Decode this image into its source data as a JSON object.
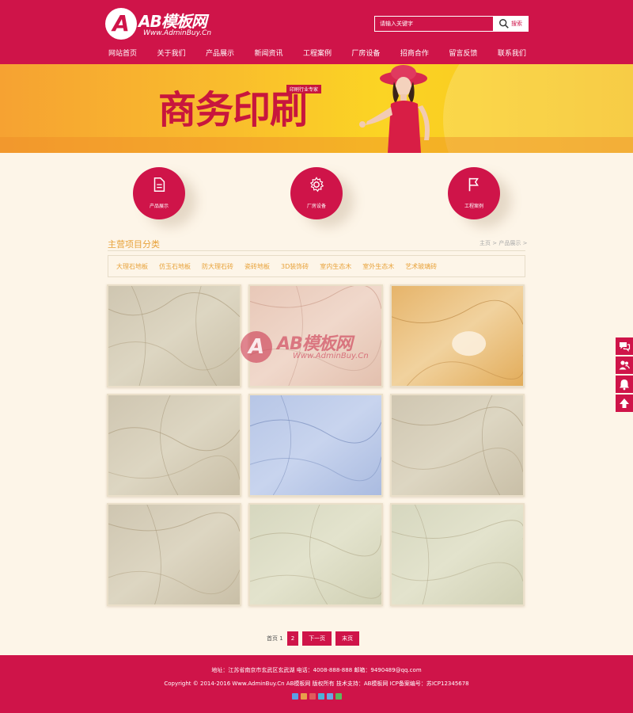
{
  "logo": {
    "mark": "A",
    "title": "AB模板网",
    "subtitle": "Www.AdminBuy.Cn"
  },
  "search": {
    "placeholder": "请输入关键字",
    "button_label": "搜索"
  },
  "nav": [
    {
      "label": "网站首页"
    },
    {
      "label": "关于我们"
    },
    {
      "label": "产品展示"
    },
    {
      "label": "新闻资讯"
    },
    {
      "label": "工程案例"
    },
    {
      "label": "厂房设备"
    },
    {
      "label": "招商合作"
    },
    {
      "label": "留言反馈"
    },
    {
      "label": "联系我们"
    }
  ],
  "banner": {
    "title": "商务印刷",
    "tag": "印刷行业专家"
  },
  "features": [
    {
      "label": "产品展示",
      "icon": "document-icon"
    },
    {
      "label": "厂房设备",
      "icon": "gear-icon"
    },
    {
      "label": "工程案例",
      "icon": "flag-icon"
    }
  ],
  "section": {
    "title": "主营项目分类"
  },
  "breadcrumb": {
    "home": "主页",
    "current": "产品展示"
  },
  "categories": [
    {
      "label": "大理石地板"
    },
    {
      "label": "仿玉石地板"
    },
    {
      "label": "防大理石砖"
    },
    {
      "label": "瓷砖地板"
    },
    {
      "label": "3D装饰砖"
    },
    {
      "label": "室内生态木"
    },
    {
      "label": "室外生态木"
    },
    {
      "label": "艺术玻璃砖"
    }
  ],
  "products": [
    {
      "texture": "beige-grey-marble"
    },
    {
      "texture": "pink-marble"
    },
    {
      "texture": "golden-marble"
    },
    {
      "texture": "beige-grey-marble"
    },
    {
      "texture": "blue-marble"
    },
    {
      "texture": "beige-grey-marble"
    },
    {
      "texture": "beige-grey-marble"
    },
    {
      "texture": "pale-green-marble"
    },
    {
      "texture": "pale-green-marble"
    }
  ],
  "watermark": {
    "mark": "A",
    "title": "AB模板网",
    "subtitle": "Www.AdminBuy.Cn"
  },
  "pagination": {
    "info": "首页 1",
    "page2": "2",
    "next": "下一页",
    "last": "末页"
  },
  "side_buttons": [
    {
      "icon": "chat-icon"
    },
    {
      "icon": "users-icon"
    },
    {
      "icon": "bell-icon"
    },
    {
      "icon": "arrow-up-icon"
    }
  ],
  "footer": {
    "line1": "地址：江苏省南京市玄武区玄武湖    电话：4008-888-888    邮箱：9490489@qq.com",
    "line2": "Copyright © 2014-2016 Www.AdminBuy.Cn AB模板网 版权所有    技术支持：AB模板网    ICP备案编号：苏ICP12345678",
    "share_colors": [
      "#5aa0e6",
      "#e8a04b",
      "#e05c5c",
      "#4cb3d8",
      "#6aa8e0",
      "#5cb85c"
    ]
  },
  "colors": {
    "brand": "#cf1449",
    "accent": "#e8a23a",
    "background": "#fdf5e8"
  }
}
